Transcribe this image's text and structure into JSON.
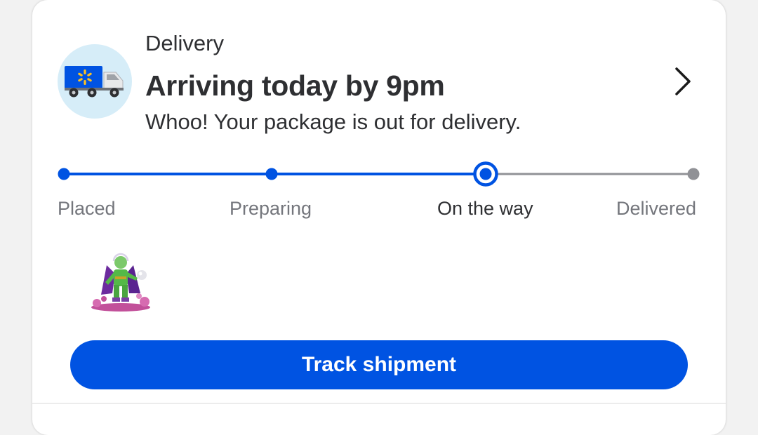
{
  "delivery_card": {
    "eyebrow": "Delivery",
    "title": "Arriving today by 9pm",
    "subtitle": "Whoo! Your package is out for delivery.",
    "icon": "delivery-truck-icon",
    "open_details_icon": "chevron-right-icon"
  },
  "progress": {
    "steps": [
      {
        "label": "Placed",
        "status": "complete"
      },
      {
        "label": "Preparing",
        "status": "complete"
      },
      {
        "label": "On the way",
        "status": "current"
      },
      {
        "label": "Delivered",
        "status": "upcoming"
      }
    ],
    "completed_color": "#0053e2",
    "upcoming_color": "#909196"
  },
  "items": [
    {
      "image": "action-figure-thumbnail"
    }
  ],
  "actions": {
    "track_label": "Track shipment"
  },
  "colors": {
    "primary": "#0053e2",
    "text": "#2e2f32",
    "muted_text": "#74767c",
    "icon_bg": "#d6edf8",
    "spark": "#ffc220"
  }
}
